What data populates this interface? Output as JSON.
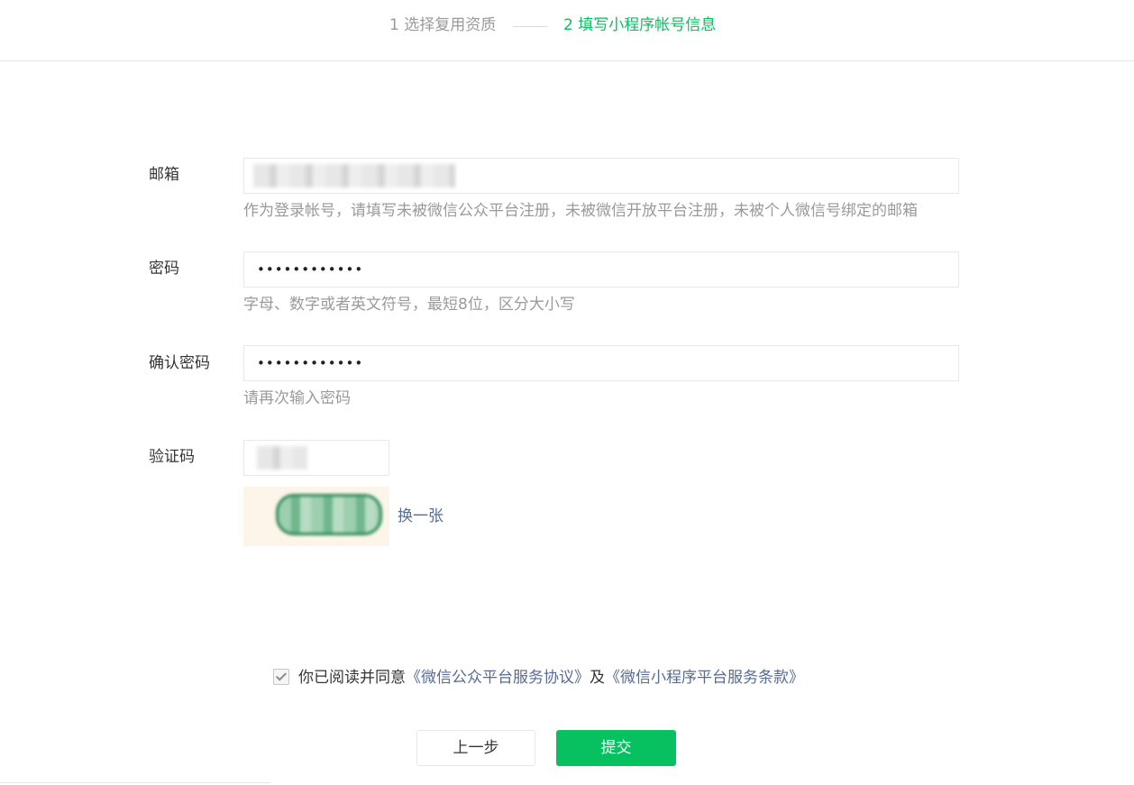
{
  "steps": {
    "step1": "1 选择复用资质",
    "step2": "2 填写小程序帐号信息"
  },
  "form": {
    "email": {
      "label": "邮箱",
      "hint": "作为登录帐号，请填写未被微信公众平台注册，未被微信开放平台注册，未被个人微信号绑定的邮箱"
    },
    "password": {
      "label": "密码",
      "value": "••••••••••••",
      "hint": "字母、数字或者英文符号，最短8位，区分大小写"
    },
    "confirm_password": {
      "label": "确认密码",
      "value": "••••••••••••",
      "hint": "请再次输入密码"
    },
    "captcha": {
      "label": "验证码",
      "refresh": "换一张"
    }
  },
  "agreement": {
    "text": "你已阅读并同意",
    "link1": "《微信公众平台服务协议》",
    "and": "及",
    "link2": "《微信小程序平台服务条款》",
    "checked": true
  },
  "buttons": {
    "prev": "上一步",
    "submit": "提交"
  },
  "colors": {
    "accent": "#07c160",
    "link": "#576b95",
    "muted": "#9a9a9a"
  }
}
